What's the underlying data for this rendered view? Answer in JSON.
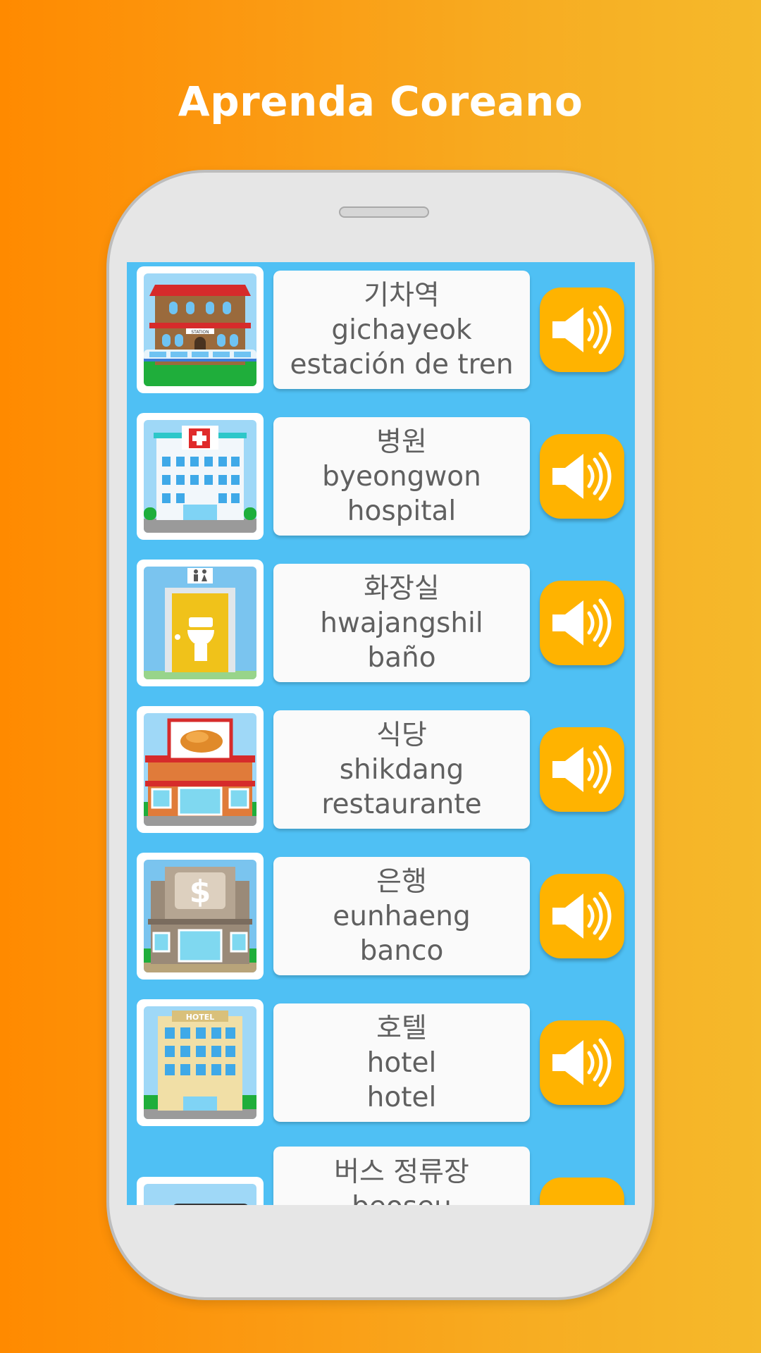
{
  "header": {
    "title": "Aprenda Coreano"
  },
  "colors": {
    "accent": "#ffb300",
    "list_background": "#4fc0f4",
    "card": "#fafafa"
  },
  "items": [
    {
      "korean": "기차역",
      "romanization": "gichayeok",
      "translation": "estación de tren",
      "image": "train-station-icon"
    },
    {
      "korean": "병원",
      "romanization": "byeongwon",
      "translation": "hospital",
      "image": "hospital-icon"
    },
    {
      "korean": "화장실",
      "romanization": "hwajangshil",
      "translation": "baño",
      "image": "restroom-icon"
    },
    {
      "korean": "식당",
      "romanization": "shikdang",
      "translation": "restaurante",
      "image": "restaurant-icon"
    },
    {
      "korean": "은행",
      "romanization": "eunhaeng",
      "translation": "banco",
      "image": "bank-icon"
    },
    {
      "korean": "호텔",
      "romanization": "hotel",
      "translation": "hotel",
      "image": "hotel-icon"
    },
    {
      "korean": "버스 정류장",
      "romanization": "beoseu",
      "translation": "",
      "image": "bus-stop-icon"
    }
  ],
  "image_labels": {
    "station": "STATION",
    "hotel": "HOTEL",
    "bank": "$"
  },
  "sound_icon": "speaker-icon"
}
